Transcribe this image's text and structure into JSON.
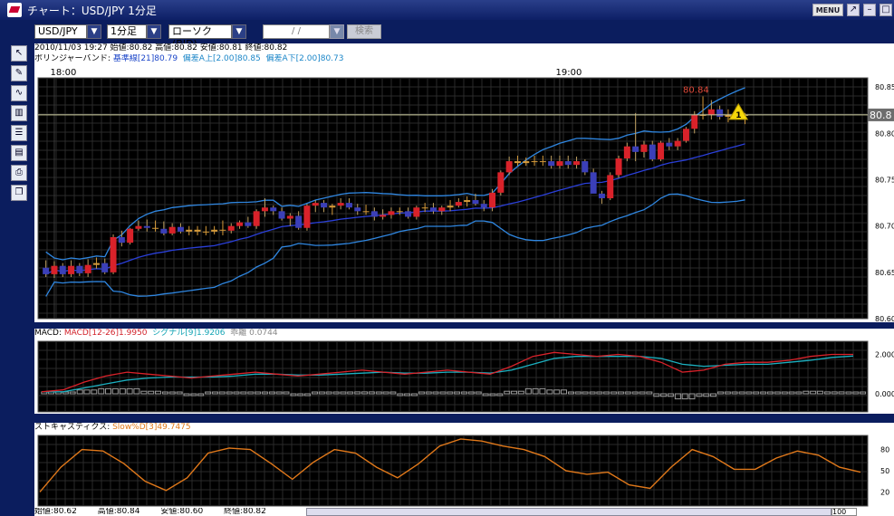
{
  "window": {
    "title": "チャート：USD/JPY 1分足",
    "menu_label": "MENU"
  },
  "toolbar": {
    "symbol": "USD/JPY",
    "timeframe": "1分足",
    "chart_type": "ローソク(BID)",
    "date_placeholder": "/ /",
    "search_label": "検索"
  },
  "info": {
    "ohlc": "2010/11/03 19:27  始値:80.82  高値:80.82  安値:80.81  終値:80.82",
    "bollinger_label": "ボリンジャーバンド: ",
    "bollinger_mid": "基準線[21]80.79",
    "bollinger_up": "偏差A上[2.00]80.85",
    "bollinger_dn": "偏差A下[2.00]80.73"
  },
  "main_chart": {
    "time_labels": [
      {
        "label": "18:00",
        "index": 1
      },
      {
        "label": "19:00",
        "index": 61
      }
    ],
    "price_ticks": [
      80.85,
      80.8,
      80.75,
      80.7,
      80.65,
      80.6
    ],
    "current_price": "80.8",
    "high_marker": "80.84",
    "ylim": [
      80.6,
      80.86
    ],
    "colors": {
      "up": "#d9222a",
      "down": "#3b3fb8",
      "doji": "#d59a3a",
      "band": "#2f86e0",
      "mid": "#2a3fd8"
    }
  },
  "macd": {
    "label": "MACD: ",
    "macd_text": "MACD[12-26]1.9950",
    "signal_text": "シグナル[9]1.9206",
    "div_text": "乖離 0.0744",
    "ticks": [
      "2.000",
      "0.000"
    ]
  },
  "stochastics": {
    "label": "ストキャスティクス: ",
    "slow_text": "Slow%D[3]49.7475",
    "ticks": [
      "80",
      "50",
      "20"
    ]
  },
  "footer": {
    "open": "始値:80.62",
    "high": "高値:80.84",
    "low": "安値:80.60",
    "close": "終値:80.82",
    "zoom": "100"
  },
  "chart_data": [
    {
      "type": "candlestick",
      "title": "USD/JPY 1分足",
      "ylim": [
        80.6,
        80.86
      ],
      "note_series": "ohlc per 1-minute bar, 18:00 start",
      "ohlc": [
        [
          80.655,
          80.663,
          80.645,
          80.648
        ],
        [
          80.648,
          80.662,
          80.644,
          80.657
        ],
        [
          80.657,
          80.66,
          80.645,
          80.648
        ],
        [
          80.648,
          80.663,
          80.645,
          80.657
        ],
        [
          80.657,
          80.66,
          80.646,
          80.649
        ],
        [
          80.649,
          80.664,
          80.645,
          80.658
        ],
        [
          80.658,
          80.666,
          80.654,
          80.66
        ],
        [
          80.66,
          80.665,
          80.648,
          80.65
        ],
        [
          80.65,
          80.691,
          80.648,
          80.688
        ],
        [
          80.688,
          80.695,
          80.678,
          80.682
        ],
        [
          80.682,
          80.698,
          80.68,
          80.697
        ],
        [
          80.697,
          80.706,
          80.695,
          80.7
        ],
        [
          80.7,
          80.707,
          80.694,
          80.698
        ],
        [
          80.698,
          80.706,
          80.694,
          80.697
        ],
        [
          80.697,
          80.705,
          80.69,
          80.692
        ],
        [
          80.692,
          80.703,
          80.69,
          80.699
        ],
        [
          80.699,
          80.703,
          80.692,
          80.694
        ],
        [
          80.694,
          80.7,
          80.69,
          80.696
        ],
        [
          80.696,
          80.7,
          80.69,
          80.694
        ],
        [
          80.694,
          80.7,
          80.69,
          80.694
        ],
        [
          80.694,
          80.7,
          80.691,
          80.696
        ],
        [
          80.696,
          80.706,
          80.69,
          80.695
        ],
        [
          80.695,
          80.703,
          80.692,
          80.7
        ],
        [
          80.7,
          80.706,
          80.697,
          80.704
        ],
        [
          80.704,
          80.71,
          80.698,
          80.7
        ],
        [
          80.7,
          80.718,
          80.697,
          80.716
        ],
        [
          80.716,
          80.73,
          80.71,
          80.72
        ],
        [
          80.72,
          80.722,
          80.712,
          80.716
        ],
        [
          80.716,
          80.72,
          80.706,
          80.708
        ],
        [
          80.708,
          80.714,
          80.7,
          80.711
        ],
        [
          80.711,
          80.716,
          80.696,
          80.698
        ],
        [
          80.698,
          80.724,
          80.695,
          80.722
        ],
        [
          80.722,
          80.728,
          80.715,
          80.725
        ],
        [
          80.725,
          80.728,
          80.715,
          80.72
        ],
        [
          80.72,
          80.724,
          80.712,
          80.722
        ],
        [
          80.722,
          80.73,
          80.718,
          80.725
        ],
        [
          80.725,
          80.73,
          80.718,
          80.72
        ],
        [
          80.72,
          80.724,
          80.712,
          80.716
        ],
        [
          80.716,
          80.723,
          80.712,
          80.716
        ],
        [
          80.716,
          80.72,
          80.706,
          80.71
        ],
        [
          80.71,
          80.718,
          80.707,
          80.712
        ],
        [
          80.712,
          80.72,
          80.708,
          80.716
        ],
        [
          80.716,
          80.72,
          80.712,
          80.716
        ],
        [
          80.716,
          80.72,
          80.708,
          80.71
        ],
        [
          80.71,
          80.722,
          80.707,
          80.72
        ],
        [
          80.72,
          80.725,
          80.715,
          80.72
        ],
        [
          80.72,
          80.725,
          80.713,
          80.716
        ],
        [
          80.716,
          80.722,
          80.712,
          80.72
        ],
        [
          80.72,
          80.728,
          80.716,
          80.722
        ],
        [
          80.722,
          80.73,
          80.72,
          80.726
        ],
        [
          80.726,
          80.732,
          80.721,
          80.728
        ],
        [
          80.728,
          80.735,
          80.722,
          80.724
        ],
        [
          80.724,
          80.728,
          80.716,
          80.72
        ],
        [
          80.72,
          80.74,
          80.716,
          80.736
        ],
        [
          80.736,
          80.76,
          80.733,
          80.758
        ],
        [
          80.758,
          80.775,
          80.755,
          80.77
        ],
        [
          80.77,
          80.776,
          80.765,
          80.768
        ],
        [
          80.768,
          80.774,
          80.765,
          80.77
        ],
        [
          80.77,
          80.776,
          80.765,
          80.77
        ],
        [
          80.77,
          80.776,
          80.765,
          80.77
        ],
        [
          80.77,
          80.776,
          80.762,
          80.765
        ],
        [
          80.765,
          80.776,
          80.762,
          80.77
        ],
        [
          80.77,
          80.776,
          80.762,
          80.766
        ],
        [
          80.766,
          80.775,
          80.762,
          80.77
        ],
        [
          80.77,
          80.772,
          80.755,
          80.758
        ],
        [
          80.758,
          80.762,
          80.75,
          80.735
        ],
        [
          80.735,
          80.738,
          80.724,
          80.73
        ],
        [
          80.73,
          80.758,
          80.728,
          80.755
        ],
        [
          80.755,
          80.776,
          80.752,
          80.773
        ],
        [
          80.773,
          80.79,
          80.77,
          80.786
        ],
        [
          80.786,
          80.822,
          80.77,
          80.78
        ],
        [
          80.78,
          80.792,
          80.774,
          80.788
        ],
        [
          80.788,
          80.792,
          80.77,
          80.772
        ],
        [
          80.772,
          80.792,
          80.77,
          80.79
        ],
        [
          80.79,
          80.795,
          80.782,
          80.786
        ],
        [
          80.786,
          80.795,
          80.782,
          80.792
        ],
        [
          80.792,
          80.807,
          80.79,
          80.805
        ],
        [
          80.805,
          80.824,
          80.8,
          80.82
        ],
        [
          80.82,
          80.84,
          80.815,
          80.82
        ],
        [
          80.82,
          80.836,
          80.815,
          80.826
        ],
        [
          80.826,
          80.83,
          80.815,
          80.818
        ],
        [
          80.818,
          80.826,
          80.812,
          80.82
        ],
        [
          80.82,
          80.826,
          80.815,
          80.82
        ],
        [
          80.82,
          80.822,
          80.81,
          80.82
        ]
      ]
    },
    {
      "type": "line",
      "title": "MACD",
      "series": [
        {
          "name": "MACD[12-26]",
          "values": [
            0.1,
            0.2,
            0.6,
            0.9,
            1.1,
            1.0,
            0.9,
            0.8,
            0.9,
            1.0,
            1.1,
            1.0,
            0.9,
            1.0,
            1.1,
            1.2,
            1.1,
            1.0,
            1.1,
            1.2,
            1.1,
            1.0,
            1.4,
            1.9,
            2.1,
            2.0,
            1.9,
            2.0,
            1.9,
            1.6,
            1.1,
            1.2,
            1.5,
            1.6,
            1.6,
            1.7,
            1.9,
            2.0,
            2.0
          ]
        },
        {
          "name": "シグナル[9]",
          "values": [
            0.1,
            0.1,
            0.3,
            0.5,
            0.7,
            0.8,
            0.85,
            0.85,
            0.85,
            0.9,
            1.0,
            1.0,
            0.95,
            0.95,
            1.0,
            1.05,
            1.1,
            1.05,
            1.05,
            1.1,
            1.1,
            1.05,
            1.2,
            1.5,
            1.8,
            1.9,
            1.9,
            1.9,
            1.9,
            1.8,
            1.5,
            1.4,
            1.45,
            1.5,
            1.5,
            1.6,
            1.7,
            1.85,
            1.92
          ]
        }
      ],
      "ticks": [
        2.0,
        0.0
      ]
    },
    {
      "type": "line",
      "title": "ストキャスティクス",
      "series": [
        {
          "name": "Slow%D[3]",
          "values": [
            20,
            55,
            80,
            78,
            60,
            35,
            22,
            40,
            75,
            82,
            80,
            60,
            38,
            62,
            80,
            75,
            55,
            40,
            60,
            85,
            95,
            92,
            85,
            80,
            70,
            50,
            45,
            48,
            30,
            25,
            55,
            80,
            70,
            52,
            52,
            68,
            78,
            72,
            55,
            48
          ]
        }
      ],
      "ticks": [
        80,
        50,
        20
      ]
    }
  ]
}
